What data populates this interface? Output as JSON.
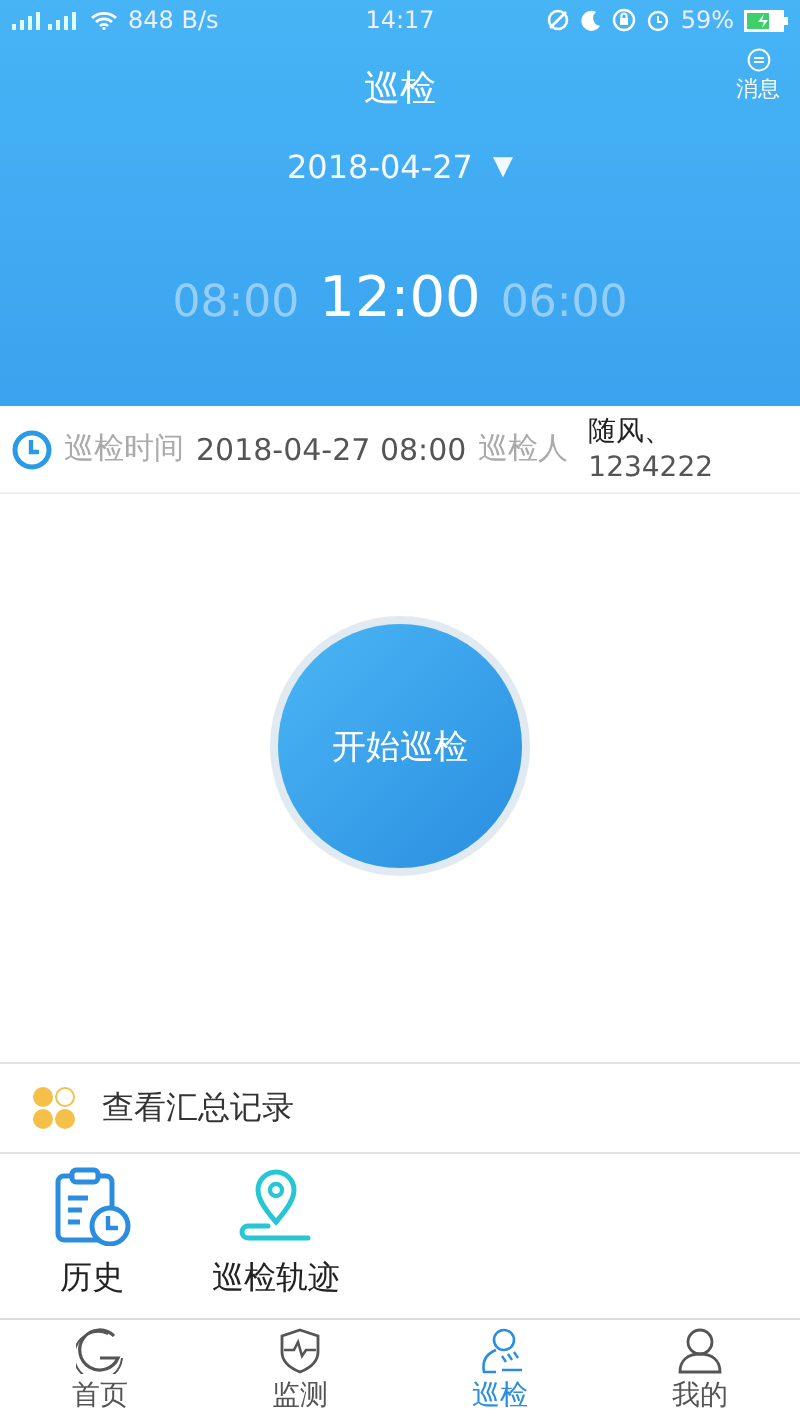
{
  "status_bar": {
    "speed": "848 B/s",
    "time": "14:17",
    "battery": "59%"
  },
  "header": {
    "title": "巡检",
    "message_label": "消息",
    "date": "2018-04-27",
    "date_caret": "▼",
    "times": [
      {
        "label": "08:00",
        "selected": false
      },
      {
        "label": "12:00",
        "selected": true
      },
      {
        "label": "06:00",
        "selected": false
      }
    ]
  },
  "info": {
    "time_label": "巡检时间",
    "time_value": "2018-04-27 08:00",
    "inspector_label": "巡检人",
    "inspector_name": "随风、",
    "inspector_id": "1234222"
  },
  "start_button": "开始巡检",
  "summary_link": "查看汇总记录",
  "shortcuts": [
    {
      "kind": "history",
      "label": "历史"
    },
    {
      "kind": "track",
      "label": "巡检轨迹"
    }
  ],
  "tab_bar": [
    {
      "kind": "home",
      "label": "首页",
      "selected": false
    },
    {
      "kind": "monitor",
      "label": "监测",
      "selected": false
    },
    {
      "kind": "patrol",
      "label": "巡检",
      "selected": true
    },
    {
      "kind": "me",
      "label": "我的",
      "selected": false
    }
  ]
}
